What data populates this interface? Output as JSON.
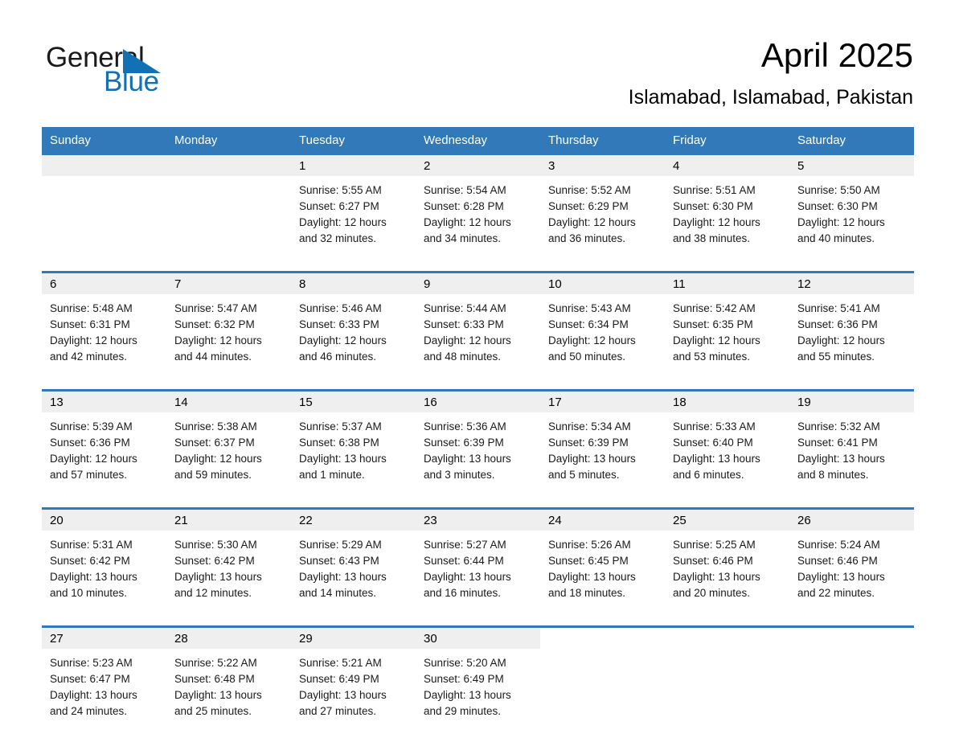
{
  "brand": {
    "name_part1": "General",
    "name_part2": "Blue",
    "accent_color": "#1270b5",
    "header_color": "#3179b8"
  },
  "header": {
    "title": "April 2025",
    "subtitle": "Islamabad, Islamabad, Pakistan"
  },
  "weekday_headers": [
    "Sunday",
    "Monday",
    "Tuesday",
    "Wednesday",
    "Thursday",
    "Friday",
    "Saturday"
  ],
  "weeks": [
    [
      {
        "day": "",
        "lines": []
      },
      {
        "day": "",
        "lines": []
      },
      {
        "day": "1",
        "lines": [
          "Sunrise: 5:55 AM",
          "Sunset: 6:27 PM",
          "Daylight: 12 hours",
          "and 32 minutes."
        ]
      },
      {
        "day": "2",
        "lines": [
          "Sunrise: 5:54 AM",
          "Sunset: 6:28 PM",
          "Daylight: 12 hours",
          "and 34 minutes."
        ]
      },
      {
        "day": "3",
        "lines": [
          "Sunrise: 5:52 AM",
          "Sunset: 6:29 PM",
          "Daylight: 12 hours",
          "and 36 minutes."
        ]
      },
      {
        "day": "4",
        "lines": [
          "Sunrise: 5:51 AM",
          "Sunset: 6:30 PM",
          "Daylight: 12 hours",
          "and 38 minutes."
        ]
      },
      {
        "day": "5",
        "lines": [
          "Sunrise: 5:50 AM",
          "Sunset: 6:30 PM",
          "Daylight: 12 hours",
          "and 40 minutes."
        ]
      }
    ],
    [
      {
        "day": "6",
        "lines": [
          "Sunrise: 5:48 AM",
          "Sunset: 6:31 PM",
          "Daylight: 12 hours",
          "and 42 minutes."
        ]
      },
      {
        "day": "7",
        "lines": [
          "Sunrise: 5:47 AM",
          "Sunset: 6:32 PM",
          "Daylight: 12 hours",
          "and 44 minutes."
        ]
      },
      {
        "day": "8",
        "lines": [
          "Sunrise: 5:46 AM",
          "Sunset: 6:33 PM",
          "Daylight: 12 hours",
          "and 46 minutes."
        ]
      },
      {
        "day": "9",
        "lines": [
          "Sunrise: 5:44 AM",
          "Sunset: 6:33 PM",
          "Daylight: 12 hours",
          "and 48 minutes."
        ]
      },
      {
        "day": "10",
        "lines": [
          "Sunrise: 5:43 AM",
          "Sunset: 6:34 PM",
          "Daylight: 12 hours",
          "and 50 minutes."
        ]
      },
      {
        "day": "11",
        "lines": [
          "Sunrise: 5:42 AM",
          "Sunset: 6:35 PM",
          "Daylight: 12 hours",
          "and 53 minutes."
        ]
      },
      {
        "day": "12",
        "lines": [
          "Sunrise: 5:41 AM",
          "Sunset: 6:36 PM",
          "Daylight: 12 hours",
          "and 55 minutes."
        ]
      }
    ],
    [
      {
        "day": "13",
        "lines": [
          "Sunrise: 5:39 AM",
          "Sunset: 6:36 PM",
          "Daylight: 12 hours",
          "and 57 minutes."
        ]
      },
      {
        "day": "14",
        "lines": [
          "Sunrise: 5:38 AM",
          "Sunset: 6:37 PM",
          "Daylight: 12 hours",
          "and 59 minutes."
        ]
      },
      {
        "day": "15",
        "lines": [
          "Sunrise: 5:37 AM",
          "Sunset: 6:38 PM",
          "Daylight: 13 hours",
          "and 1 minute."
        ]
      },
      {
        "day": "16",
        "lines": [
          "Sunrise: 5:36 AM",
          "Sunset: 6:39 PM",
          "Daylight: 13 hours",
          "and 3 minutes."
        ]
      },
      {
        "day": "17",
        "lines": [
          "Sunrise: 5:34 AM",
          "Sunset: 6:39 PM",
          "Daylight: 13 hours",
          "and 5 minutes."
        ]
      },
      {
        "day": "18",
        "lines": [
          "Sunrise: 5:33 AM",
          "Sunset: 6:40 PM",
          "Daylight: 13 hours",
          "and 6 minutes."
        ]
      },
      {
        "day": "19",
        "lines": [
          "Sunrise: 5:32 AM",
          "Sunset: 6:41 PM",
          "Daylight: 13 hours",
          "and 8 minutes."
        ]
      }
    ],
    [
      {
        "day": "20",
        "lines": [
          "Sunrise: 5:31 AM",
          "Sunset: 6:42 PM",
          "Daylight: 13 hours",
          "and 10 minutes."
        ]
      },
      {
        "day": "21",
        "lines": [
          "Sunrise: 5:30 AM",
          "Sunset: 6:42 PM",
          "Daylight: 13 hours",
          "and 12 minutes."
        ]
      },
      {
        "day": "22",
        "lines": [
          "Sunrise: 5:29 AM",
          "Sunset: 6:43 PM",
          "Daylight: 13 hours",
          "and 14 minutes."
        ]
      },
      {
        "day": "23",
        "lines": [
          "Sunrise: 5:27 AM",
          "Sunset: 6:44 PM",
          "Daylight: 13 hours",
          "and 16 minutes."
        ]
      },
      {
        "day": "24",
        "lines": [
          "Sunrise: 5:26 AM",
          "Sunset: 6:45 PM",
          "Daylight: 13 hours",
          "and 18 minutes."
        ]
      },
      {
        "day": "25",
        "lines": [
          "Sunrise: 5:25 AM",
          "Sunset: 6:46 PM",
          "Daylight: 13 hours",
          "and 20 minutes."
        ]
      },
      {
        "day": "26",
        "lines": [
          "Sunrise: 5:24 AM",
          "Sunset: 6:46 PM",
          "Daylight: 13 hours",
          "and 22 minutes."
        ]
      }
    ],
    [
      {
        "day": "27",
        "lines": [
          "Sunrise: 5:23 AM",
          "Sunset: 6:47 PM",
          "Daylight: 13 hours",
          "and 24 minutes."
        ]
      },
      {
        "day": "28",
        "lines": [
          "Sunrise: 5:22 AM",
          "Sunset: 6:48 PM",
          "Daylight: 13 hours",
          "and 25 minutes."
        ]
      },
      {
        "day": "29",
        "lines": [
          "Sunrise: 5:21 AM",
          "Sunset: 6:49 PM",
          "Daylight: 13 hours",
          "and 27 minutes."
        ]
      },
      {
        "day": "30",
        "lines": [
          "Sunrise: 5:20 AM",
          "Sunset: 6:49 PM",
          "Daylight: 13 hours",
          "and 29 minutes."
        ]
      },
      {
        "day": "",
        "lines": []
      },
      {
        "day": "",
        "lines": []
      },
      {
        "day": "",
        "lines": []
      }
    ]
  ]
}
